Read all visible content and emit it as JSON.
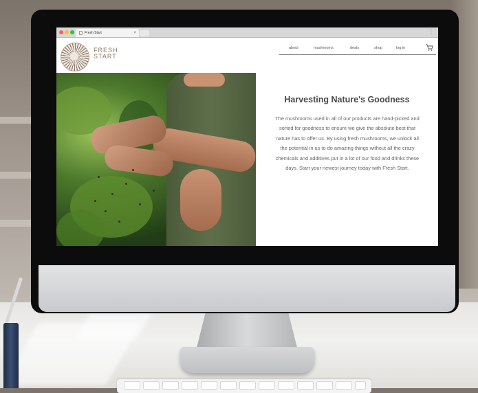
{
  "browser": {
    "tab_title": "Fresh Start",
    "close_glyph": "×",
    "menu_glyph": "⋮",
    "traffic_colors": [
      "#ff5f57",
      "#febc2e",
      "#28c840"
    ]
  },
  "site": {
    "brand_line1": "FRESH",
    "brand_line2": "START",
    "nav": [
      "about",
      "mushrooms",
      "deals",
      "shop",
      "log in"
    ],
    "cart_icon": "cart-icon"
  },
  "hero": {
    "heading": "Harvesting Nature's Goodness",
    "paragraph": "The mushrooms used in all of our products are hand-picked and sorted for goodness to ensure we give the absolute best that nature has to offer us. By using fresh mushrooms, we unlock all the potential in us to do amazing things without all the crazy chemicals and additives put in a lot of our food and drinks these days. Start your newest journey today with Fresh Start."
  }
}
